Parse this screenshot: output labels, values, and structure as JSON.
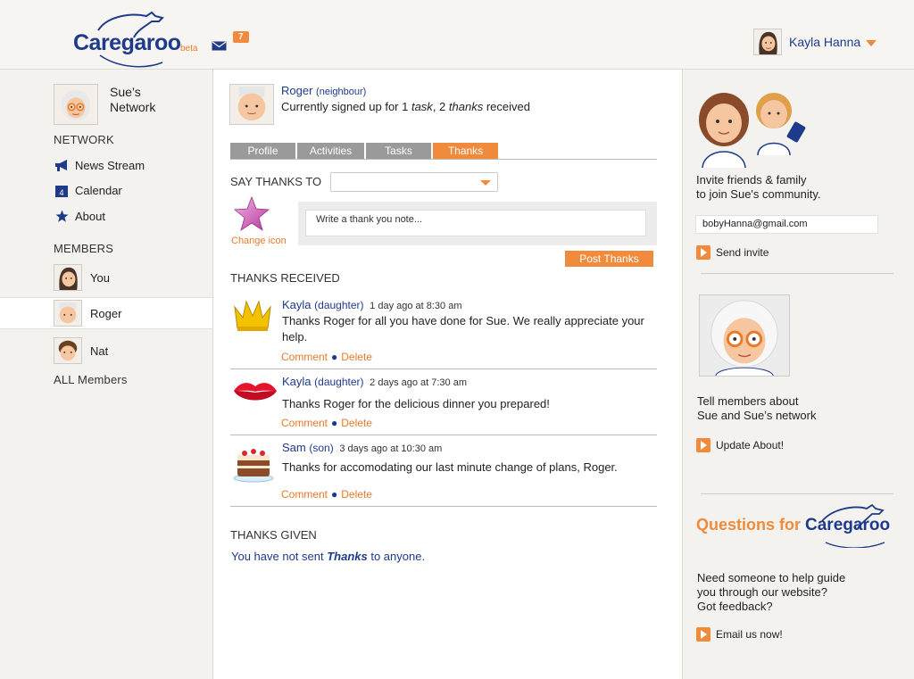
{
  "header": {
    "logo_text": "Caregaroo",
    "logo_beta": "beta",
    "notification_count": "7",
    "user_name": "Kayla Hanna"
  },
  "sidebar": {
    "network_title_line1": "Sue’s",
    "network_title_line2": "Network",
    "network_heading": "NETWORK",
    "nav": [
      {
        "label": "News Stream",
        "icon": "megaphone-icon"
      },
      {
        "label": "Calendar",
        "icon": "calendar-icon"
      },
      {
        "label": "About",
        "icon": "star-icon"
      }
    ],
    "calendar_day": "4",
    "members_heading": "MEMBERS",
    "members": [
      {
        "label": "You"
      },
      {
        "label": "Roger"
      },
      {
        "label": "Nat"
      }
    ],
    "all_members": "ALL Members"
  },
  "profile": {
    "name": "Roger",
    "relation": "(neighbour)",
    "status_prefix": "Currently signed up for 1 ",
    "status_task": "task",
    "status_mid": ", 2 ",
    "status_thanks": "thanks",
    "status_suffix": " received"
  },
  "tabs": [
    {
      "label": "Profile"
    },
    {
      "label": "Activities"
    },
    {
      "label": "Tasks"
    },
    {
      "label": "Thanks"
    }
  ],
  "say_thanks": {
    "label": "SAY THANKS TO",
    "selected": "",
    "change_icon": "Change icon",
    "note_placeholder": "Write a thank you note...",
    "post_button": "Post Thanks"
  },
  "thanks_received": {
    "heading": "THANKS RECEIVED",
    "items": [
      {
        "who": "Kayla",
        "relation": "(daughter)",
        "when": "1 day ago at 8:30 am",
        "message": "Thanks Roger for all you have done for Sue. We really appreciate your help.",
        "icon": "crown-icon",
        "comment": "Comment",
        "delete": "Delete"
      },
      {
        "who": "Kayla",
        "relation": "(daughter)",
        "when": "2 days ago at 7:30 am",
        "message": "Thanks Roger for the delicious dinner you prepared!",
        "icon": "lips-icon",
        "comment": "Comment",
        "delete": "Delete"
      },
      {
        "who": "Sam",
        "relation": "(son)",
        "when": "3 days ago at 10:30 am",
        "message": "Thanks for accomodating our last minute change of plans, Roger.",
        "icon": "cake-icon",
        "comment": "Comment",
        "delete": "Delete"
      }
    ]
  },
  "thanks_given": {
    "heading": "THANKS GIVEN",
    "message_prefix": "You have not sent ",
    "message_em": "Thanks",
    "message_suffix": " to anyone."
  },
  "right": {
    "invite_line1": "Invite friends & family",
    "invite_line2": "to join Sue's community.",
    "invite_email": "bobyHanna@gmail.com",
    "send_invite": "Send invite",
    "tell_line1": "Tell members about",
    "tell_line2": "Sue and Sue’s network",
    "update_about": "Update About!",
    "questions_for": "Questions for ",
    "questions_brand": "Caregaroo",
    "help_line1": "Need someone to help guide",
    "help_line2": "you through our website?",
    "help_line3": "Got feedback?",
    "email_us": "Email us now!"
  },
  "colors": {
    "brand_blue": "#1e3a8a",
    "accent_orange": "#f08a3c",
    "tab_gray": "#9a9a9a"
  }
}
